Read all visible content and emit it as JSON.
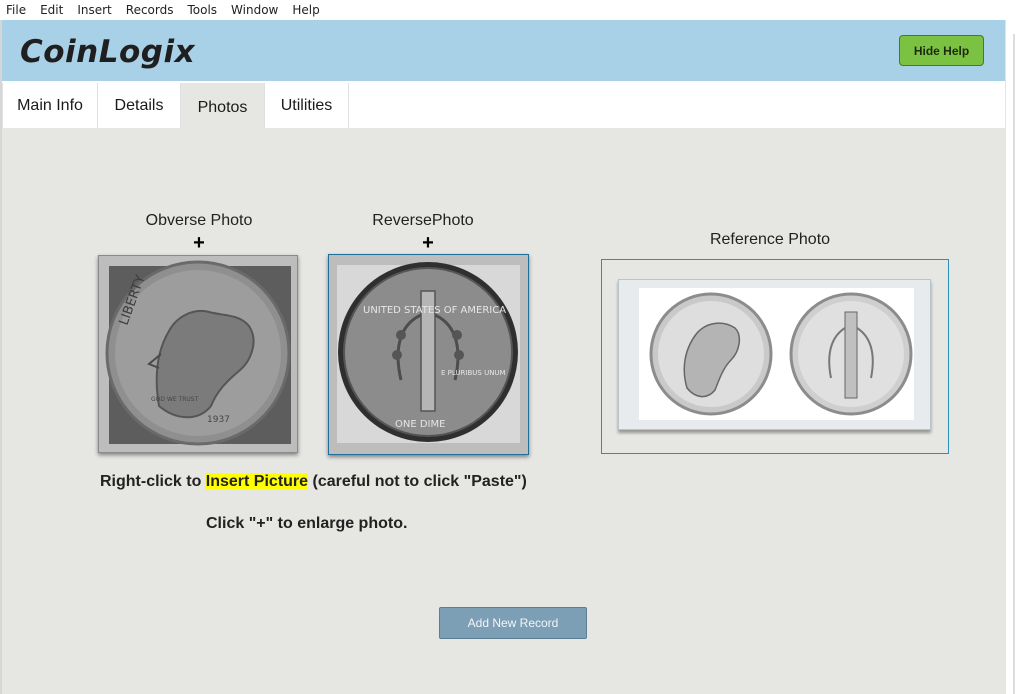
{
  "menu": [
    "File",
    "Edit",
    "Insert",
    "Records",
    "Tools",
    "Window",
    "Help"
  ],
  "header": {
    "logo": "CoinLogix",
    "hide_help_label": "Hide Help"
  },
  "tabs": [
    {
      "label": "Main Info",
      "active": false
    },
    {
      "label": "Details",
      "active": false
    },
    {
      "label": "Photos",
      "active": true
    },
    {
      "label": "Utilities",
      "active": false
    }
  ],
  "photos": {
    "obverse_label": "Obverse Photo",
    "reverse_label": "ReversePhoto",
    "reference_label": "Reference Photo",
    "enlarge_symbol": "+",
    "obverse_coin_text": [
      "LIBERTY",
      "GOD WE TRUST",
      "1937"
    ],
    "reverse_coin_text": [
      "UNITED STATES OF AMERICA",
      "E PLURIBUS UNUM",
      "ONE DIME"
    ]
  },
  "instructions": {
    "line1_prefix": "Right-click to ",
    "line1_highlight": "Insert Picture",
    "line1_suffix": " (careful not to click \"Paste\")",
    "line2": "Click \"+\" to enlarge photo."
  },
  "add_button_label": "Add New Record",
  "colors": {
    "header_bg": "#a8d0e6",
    "hide_help_bg": "#7cc242",
    "content_bg": "#e6e6e2",
    "add_button_bg": "#7d9fb5",
    "highlight": "#ffff00"
  }
}
